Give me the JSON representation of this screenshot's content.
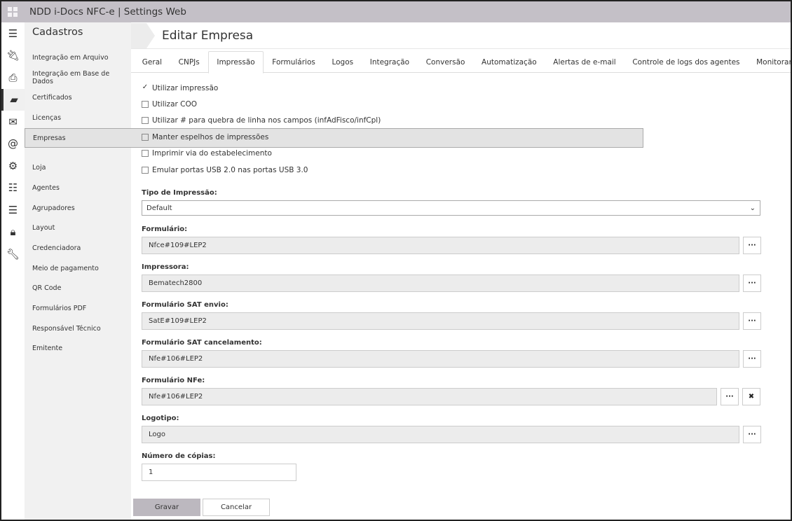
{
  "app": {
    "title": "NDD i-Docs NFC-e | Settings Web"
  },
  "rail": [
    "menu-icon",
    "plug-icon",
    "printer-icon",
    "folder-open-icon",
    "envelope-icon",
    "at-icon",
    "gear-icon",
    "sliders-icon",
    "server-icon",
    "lock-icon",
    "wrench-icon"
  ],
  "sidebar": {
    "title": "Cadastros",
    "items": [
      "Integração em Arquivo",
      "Integração em Base de Dados",
      "Certificados",
      "Licenças",
      "Empresas",
      "Loja",
      "Agentes",
      "Agrupadores",
      "Layout",
      "Credenciadora",
      "Meio de pagamento",
      "QR Code",
      "Formulários PDF",
      "Responsável Técnico",
      "Emitente"
    ],
    "selected": "Empresas"
  },
  "page": {
    "title": "Editar Empresa"
  },
  "tabs": [
    "Geral",
    "CNPJs",
    "Impressão",
    "Formulários",
    "Logos",
    "Integração",
    "Conversão",
    "Automatização",
    "Alertas de e-mail",
    "Controle de logs dos agentes",
    "Monitoramento do Agente"
  ],
  "active_tab": "Impressão",
  "checkboxes": [
    {
      "label": "Utilizar impressão",
      "checked": true
    },
    {
      "label": "Utilizar COO",
      "checked": false
    },
    {
      "label": "Utilizar # para quebra de linha nos campos (infAdFisco/infCpl)",
      "checked": false
    },
    {
      "label": "Manter espelhos de impressões",
      "checked": false
    },
    {
      "label": "Imprimir via do estabelecimento",
      "checked": false
    },
    {
      "label": "Emular portas USB 2.0 nas portas USB 3.0",
      "checked": false
    }
  ],
  "tipo": {
    "label": "Tipo de Impressão:",
    "value": "Default"
  },
  "fields": [
    {
      "label": "Formulário:",
      "value": "Nfce#109#LEP2"
    },
    {
      "label": "Impressora:",
      "value": "Bematech2800"
    },
    {
      "label": "Formulário SAT envio:",
      "value": "SatE#109#LEP2"
    },
    {
      "label": "Formulário SAT cancelamento:",
      "value": "Nfe#106#LEP2"
    },
    {
      "label": "Formulário NFe:",
      "value": "Nfe#106#LEP2"
    },
    {
      "label": "Logotipo:",
      "value": "Logo"
    }
  ],
  "copies": {
    "label": "Número de cópias:",
    "value": "1"
  },
  "buttons": {
    "browse": "···",
    "clear": "✖",
    "save": "Gravar",
    "cancel": "Cancelar"
  }
}
